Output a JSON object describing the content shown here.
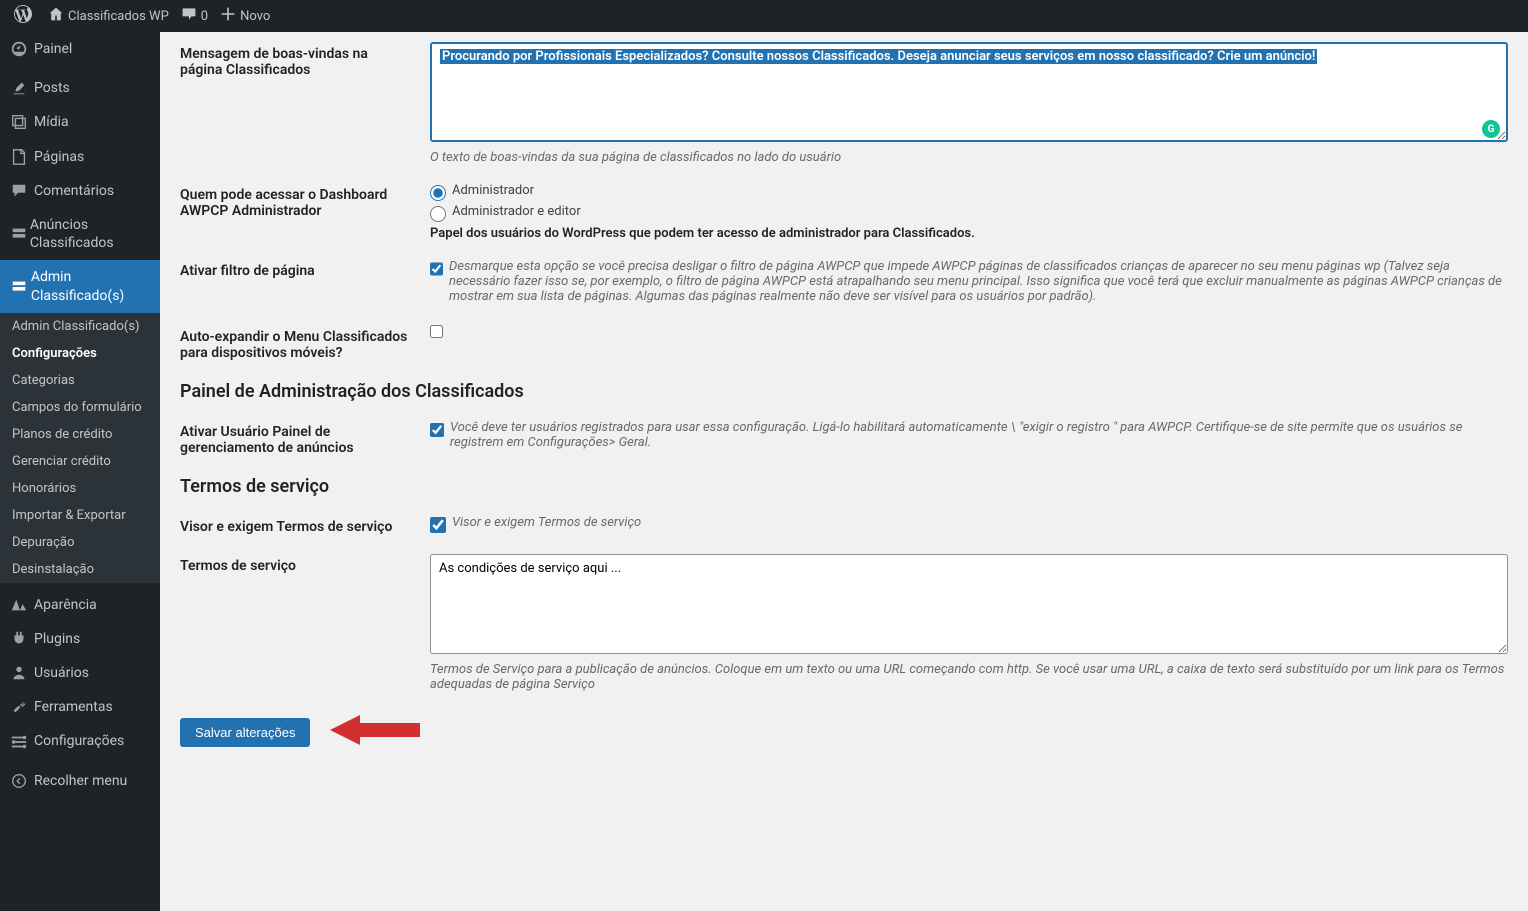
{
  "toolbar": {
    "site_name": "Classificados WP",
    "comment_count": "0",
    "new_label": "Novo"
  },
  "sidebar": {
    "painel": "Painel",
    "posts": "Posts",
    "midia": "Mídia",
    "paginas": "Páginas",
    "comentarios": "Comentários",
    "anuncios": "Anúncios Classificados",
    "admin_class": "Admin Classificado(s)",
    "aparencia": "Aparência",
    "plugins": "Plugins",
    "usuarios": "Usuários",
    "ferramentas": "Ferramentas",
    "configuracoes": "Configurações",
    "recolher": "Recolher menu"
  },
  "submenu": {
    "admin_class": "Admin Classificado(s)",
    "configuracoes": "Configurações",
    "categorias": "Categorias",
    "campos": "Campos do formulário",
    "planos": "Planos de crédito",
    "gerenciar": "Gerenciar crédito",
    "honorarios": "Honorários",
    "importar": "Importar & Exportar",
    "depuracao": "Depuração",
    "desinstalacao": "Desinstalação"
  },
  "form": {
    "welcome_label": "Mensagem de boas-vindas na página Classificados",
    "welcome_value": "Procurando por Profissionais Especializados? Consulte nossos Classificados. Deseja anunciar seus serviços em nosso classificado? Crie um anúncio!",
    "welcome_desc": "O texto de boas-vindas da sua página de classificados no lado do usuário",
    "access_label": "Quem pode acessar o Dashboard AWPCP Administrador",
    "access_opt1": "Administrador",
    "access_opt2": "Administrador e editor",
    "access_desc": "Papel dos usuários do WordPress que podem ter acesso de administrador para Classificados.",
    "filter_label": "Ativar filtro de página",
    "filter_desc": "Desmarque esta opção se você precisa desligar o filtro de página AWPCP que impede AWPCP páginas de classificados crianças de aparecer no seu menu páginas wp (Talvez seja necessário fazer isso se, por exemplo, o filtro de página AWPCP está atrapalhando seu menu principal. Isso significa que você terá que excluir manualmente as páginas AWPCP crianças de mostrar em sua lista de páginas. Algumas das páginas realmente não deve ser visível para os usuários por padrão).",
    "autoexpand_label": "Auto-expandir o Menu Classificados para dispositivos móveis?",
    "panel_heading": "Painel de Administração dos Classificados",
    "userpanel_label": "Ativar Usuário Painel de gerenciamento de anúncios",
    "userpanel_desc": "Você deve ter usuários registrados para usar essa configuração. Ligá-lo habilitará automaticamente \\ \"exigir o registro \" para AWPCP. Certifique-se de site permite que os usuários se registrem em Configurações> Geral.",
    "tos_heading": "Termos de serviço",
    "tos_require_label": "Visor e exigem Termos de serviço",
    "tos_require_check": "Visor e exigem Termos de serviço",
    "tos_label": "Termos de serviço",
    "tos_value": "As condições de serviço aqui ...",
    "tos_desc": "Termos de Serviço para a publicação de anúncios. Coloque em um texto ou uma URL começando com http. Se você usar uma URL, a caixa de texto será substituído por um link para os Termos adequadas de página Serviço",
    "save_button": "Salvar alterações"
  }
}
